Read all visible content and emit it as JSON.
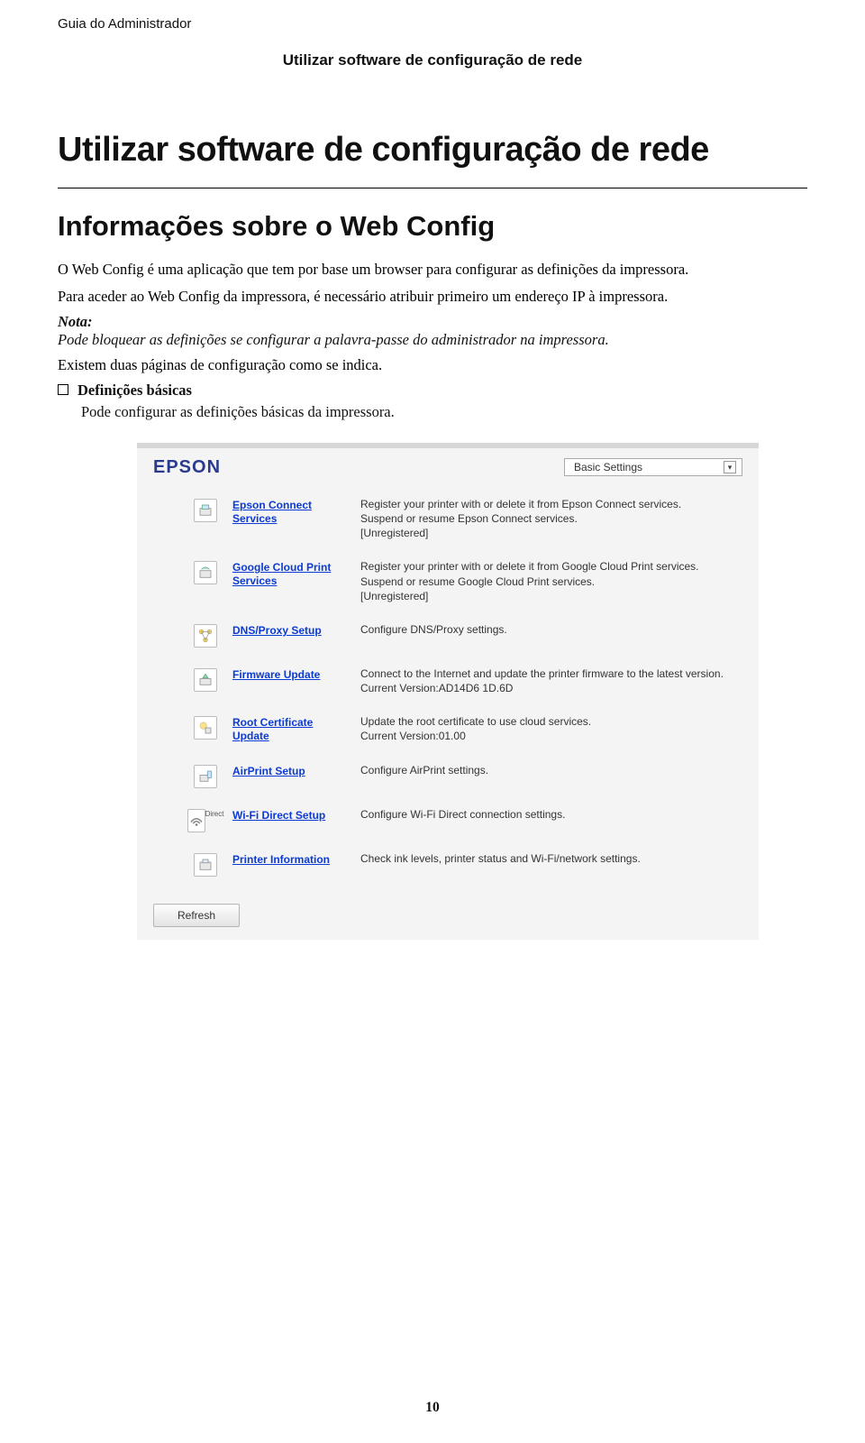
{
  "header": {
    "running": "Guia do Administrador",
    "section": "Utilizar software de configuração de rede"
  },
  "h1": "Utilizar software de configuração de rede",
  "h2": "Informações sobre o Web Config",
  "paragraphs": {
    "intro": "O Web Config é uma aplicação que tem por base um browser para configurar as definições da impressora.",
    "access": "Para aceder ao Web Config da impressora, é necessário atribuir primeiro um endereço IP à impressora.",
    "note_label": "Nota:",
    "note_body": "Pode bloquear as definições se configurar a palavra-passe do administrador na impressora.",
    "two_pages": "Existem duas páginas de configuração como se indica.",
    "bullet_title": "Definições básicas",
    "bullet_body": "Pode configurar as definições básicas da impressora."
  },
  "shot": {
    "brand": "EPSON",
    "mode": "Basic Settings",
    "rows": [
      {
        "link": "Epson Connect Services",
        "desc": "Register your printer with or delete it from Epson Connect services.\nSuspend or resume Epson Connect services.\n[Unregistered]"
      },
      {
        "link": "Google Cloud Print Services",
        "desc": "Register your printer with or delete it from Google Cloud Print services.\nSuspend or resume Google Cloud Print services.\n[Unregistered]"
      },
      {
        "link": "DNS/Proxy Setup",
        "desc": "Configure DNS/Proxy settings."
      },
      {
        "link": "Firmware Update",
        "desc": "Connect to the Internet and update the printer firmware to the latest version.\nCurrent Version:AD14D6 1D.6D"
      },
      {
        "link": "Root Certificate Update",
        "desc": "Update the root certificate to use cloud services.\nCurrent Version:01.00"
      },
      {
        "link": "AirPrint Setup",
        "desc": "Configure AirPrint settings."
      },
      {
        "link": "Wi-Fi Direct Setup",
        "desc": "Configure Wi-Fi Direct connection settings.",
        "sublabel": "Direct"
      },
      {
        "link": "Printer Information",
        "desc": "Check ink levels, printer status and Wi-Fi/network settings."
      }
    ],
    "refresh": "Refresh"
  },
  "page_number": "10"
}
